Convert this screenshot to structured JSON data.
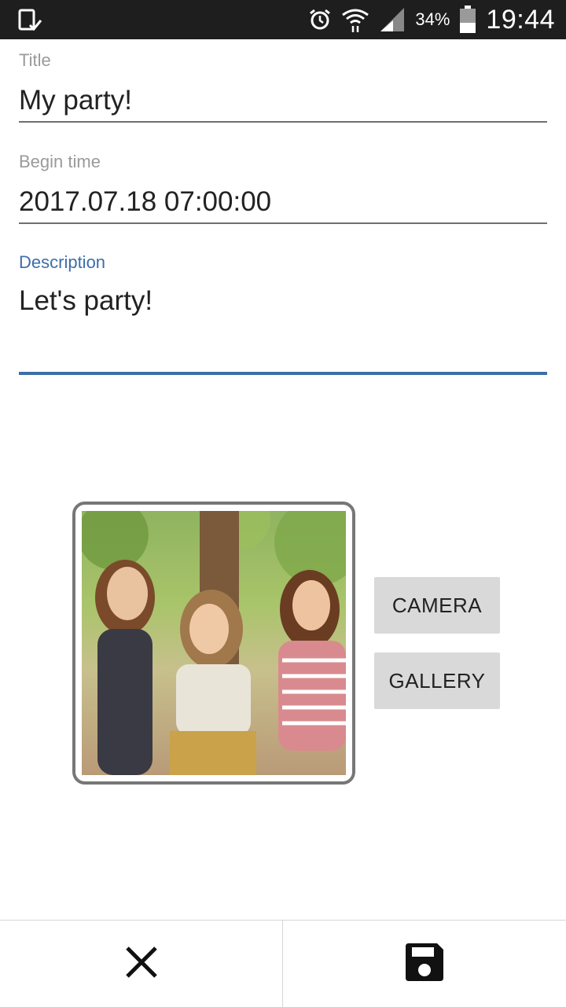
{
  "status_bar": {
    "battery_percent": "34%",
    "time": "19:44",
    "icons": [
      "screenshot-icon",
      "alarm-icon",
      "wifi-icon",
      "signal-icon",
      "battery-icon"
    ]
  },
  "form": {
    "title": {
      "label": "Title",
      "value": "My party!"
    },
    "begin_time": {
      "label": "Begin time",
      "value": "2017.07.18 07:00:00"
    },
    "description": {
      "label": "Description",
      "value": "Let's party!"
    }
  },
  "image_section": {
    "camera_label": "CAMERA",
    "gallery_label": "GALLERY"
  },
  "bottom_bar": {
    "cancel_icon": "close-icon",
    "save_icon": "save-icon"
  },
  "colors": {
    "accent": "#3d6ea8",
    "status_bar": "#1e1e1e",
    "button_bg": "#d9d9d9"
  }
}
